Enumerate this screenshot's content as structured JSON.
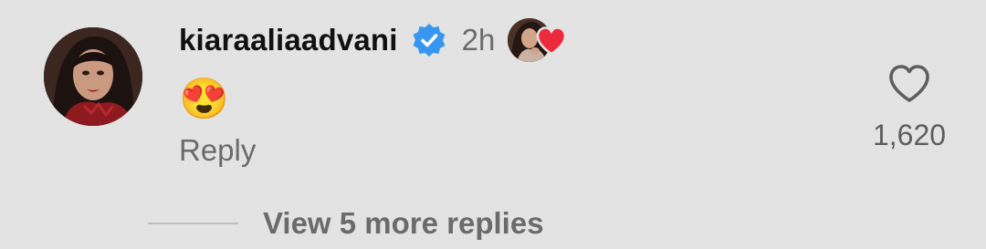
{
  "comment": {
    "username": "kiaraaliaadvani",
    "verified_icon": "verified-badge-icon",
    "timestamp": "2h",
    "creator_liked_icon": "heart-icon",
    "text": "😍",
    "reply_label": "Reply",
    "like_icon": "heart-outline-icon",
    "like_count": "1,620",
    "view_replies_label": "View 5 more replies"
  },
  "colors": {
    "background": "#e3e3e3",
    "verified_blue": "#3797f0",
    "heart_red": "#ed2a3b",
    "muted_text": "#6b6b6b"
  }
}
